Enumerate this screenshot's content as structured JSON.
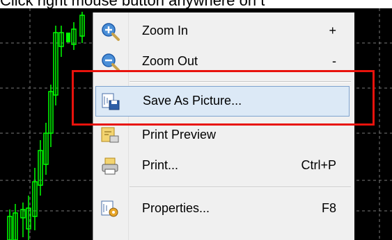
{
  "caption": "Click right mouse button anywhere on t",
  "colors": {
    "chart_bg": "#000000",
    "candle": "#00ff00",
    "menu_bg": "#f0f0f0",
    "selected_bg": "#dce9f6",
    "selected_border": "#7da2ce",
    "highlight_box": "#e8120c"
  },
  "context_menu": {
    "items": [
      {
        "label": "Zoom In",
        "shortcut": "+",
        "icon": "zoom-in-icon"
      },
      {
        "label": "Zoom Out",
        "shortcut": "-",
        "icon": "zoom-out-icon"
      },
      {
        "label": "Save As Picture...",
        "shortcut": "",
        "icon": "save-picture-icon",
        "selected": true
      },
      {
        "label": "Print Preview",
        "shortcut": "",
        "icon": "print-preview-icon"
      },
      {
        "label": "Print...",
        "shortcut": "Ctrl+P",
        "icon": "printer-icon"
      },
      {
        "label": "Properties...",
        "shortcut": "F8",
        "icon": "properties-icon"
      }
    ]
  }
}
